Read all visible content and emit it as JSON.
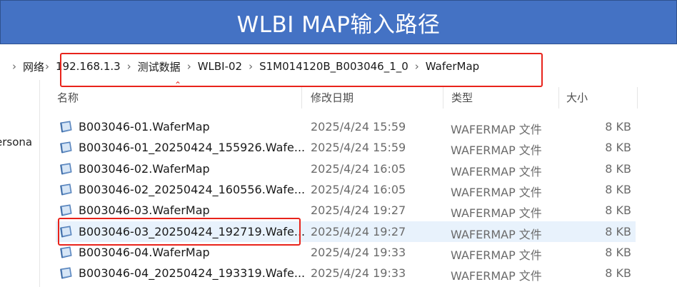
{
  "banner": {
    "title": "WLBI MAP输入路径"
  },
  "breadcrumb": {
    "items": [
      "网络",
      "192.168.1.3",
      "测试数据",
      "WLBI-02",
      "S1M014120B_B003046_1_0",
      "WaferMap"
    ]
  },
  "left_pane": {
    "partial_label": "ersona"
  },
  "columns": {
    "name": "名称",
    "modified": "修改日期",
    "type": "类型",
    "size": "大小"
  },
  "files": [
    {
      "name": "B003046-01.WaferMap",
      "modified": "2025/4/24 15:59",
      "type": "WAFERMAP 文件",
      "size": "8 KB"
    },
    {
      "name": "B003046-01_20250424_155926.Wafe...",
      "modified": "2025/4/24 15:59",
      "type": "WAFERMAP 文件",
      "size": "8 KB"
    },
    {
      "name": "B003046-02.WaferMap",
      "modified": "2025/4/24 16:05",
      "type": "WAFERMAP 文件",
      "size": "8 KB"
    },
    {
      "name": "B003046-02_20250424_160556.Wafe...",
      "modified": "2025/4/24 16:05",
      "type": "WAFERMAP 文件",
      "size": "8 KB"
    },
    {
      "name": "B003046-03.WaferMap",
      "modified": "2025/4/24 19:27",
      "type": "WAFERMAP 文件",
      "size": "8 KB"
    },
    {
      "name": "B003046-03_20250424_192719.Wafe...",
      "modified": "2025/4/24 19:27",
      "type": "WAFERMAP 文件",
      "size": "8 KB"
    },
    {
      "name": "B003046-04.WaferMap",
      "modified": "2025/4/24 19:33",
      "type": "WAFERMAP 文件",
      "size": "8 KB"
    },
    {
      "name": "B003046-04_20250424_193319.Wafe...",
      "modified": "2025/4/24 19:33",
      "type": "WAFERMAP 文件",
      "size": "8 KB"
    }
  ],
  "selected_index": 5,
  "colors": {
    "banner": "#4472c4",
    "highlight_box": "#e8231b",
    "selection": "#e8f2fc"
  },
  "icons": {
    "file": "wafermap-file-icon",
    "separator": "chevron-right-icon"
  }
}
